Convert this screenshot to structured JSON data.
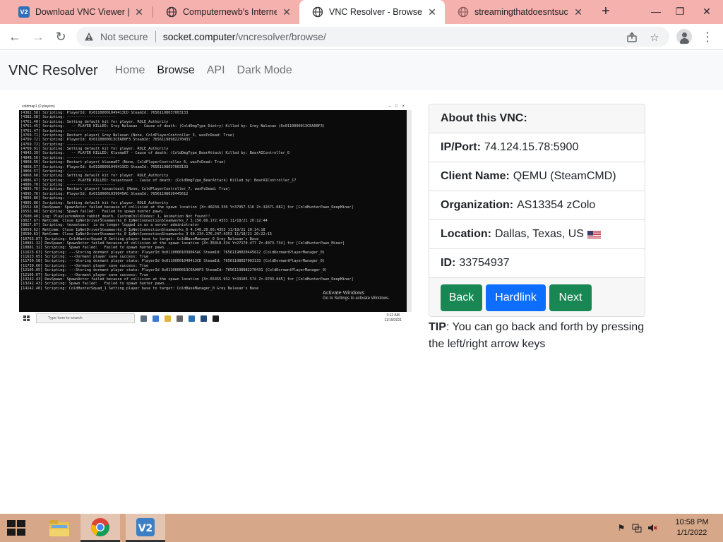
{
  "browser": {
    "tabs": [
      {
        "title": "Download VNC Viewer | VNC",
        "favicon": "vnc-icon",
        "active": false
      },
      {
        "title": "Computernewb's Internet M",
        "favicon": "globe-icon",
        "active": false
      },
      {
        "title": "VNC Resolver - Browse",
        "favicon": "globe-icon",
        "active": true
      },
      {
        "title": "streamingthatdoesntsuck.c",
        "favicon": "globe-icon",
        "active": false
      }
    ],
    "new_tab_label": "+",
    "window_controls": {
      "minimize": "—",
      "restore": "❐",
      "close": "✕"
    },
    "toolbar": {
      "back": "←",
      "forward": "→",
      "reload": "↻",
      "security_text": "Not secure",
      "url_host": "socket.computer",
      "url_path": "/vncresolver/browse/"
    }
  },
  "site": {
    "brand": "VNC Resolver",
    "nav": [
      {
        "label": "Home",
        "active": false
      },
      {
        "label": "Browse",
        "active": true
      },
      {
        "label": "API",
        "active": false
      },
      {
        "label": "Dark Mode",
        "active": false
      }
    ]
  },
  "vnc_screenshot": {
    "window_title": "coldmap1 (0 players)",
    "console_lines": [
      "[4382.58] Scripting: PlayerId: 0x01100001049413CD SteamId: 76561198037003133",
      "[4382.58] Scripting: ----------------------",
      "[4761.40] Scripting: Setting default kit for player. ROLE_Authority",
      "[4761.45] Scripting:   -- PLAYER KILLED: Grey Nalasan - Cause of death: (ColdDmgType_Dietry) Killed by: Grey Nalasan (0x0110000013CEA00F3)",
      "[4761.47] Scripting: ----------------------",
      "[4769.71] Scripting: Restart player( Grey Nalasan (None, ColdPlayerController_3, wasPcDead: True)",
      "[4769.72] Scripting: PlayerId: 0x0110000013CEA00F3 SteamId: 76561198982270431",
      "[4769.72] Scripting: ----------------------",
      "[4769.91] Scripting: Setting default kit for player. ROLE_Authority",
      "[4843.39] Scripting:   -- PLAYER KILLED: Klasma07 - Cause of death: (ColdDmgType_BearAttack) Killed by: BearAIController_0",
      "[4848.56] Scripting: ----------------------",
      "[4868.56] Scripting: Restart player( klasma07 (None, ColdPlayerController_6, wasPcDead: True)",
      "[4868.57] Scripting: PlayerId: 0x01100001049413CD SteamId: 76561198037003133",
      "[4868.57] Scripting: ----------------------",
      "[4868.60] Scripting: Setting default kit for player. ROLE_Authority",
      "[4886.47] Scripting:   -- PLAYER KILLED: texastoast - Cause of death: (ColdDmgType_BearAttack) Killed by: BearAIController_17",
      "[4886.70] Scripting: ----------------------",
      "[4895.76] Scripting: Restart player( texastoast (None, ColdPlayerController_7, wasPcDead: True)",
      "[4895.76] Scripting: PlayerId: 0x01100001039045AC SteamId: 76561198020445612",
      "[4895.86] Scripting: ----------------------",
      "[4895.86] Scripting: Setting default kit for player. ROLE_Authority",
      "[6552.68] DevSpawn: SpawnActor failed because of collision at the spawn location [X=-40234.336 Y=37957.516 Z=-32671.082] for [ColdHunterPawn_DeepMiner]",
      "[6552.68] Scripting: Spawn failed:   Failed to spawn hunter pawn...",
      "[7600.40] Log: PlayCustomAnim rabbit_death, CustomChildIndex: 1, Animation Not Found!!",
      "[8027.67] NetComm: Close IpNetDriverSteamworks_0 IpNetConnectionSteamworks_7 3.150.60.172:4353 11/18/21 20:12:44",
      "[8027.67] Scripting: texastoast  is no longer logged in as a server administrator",
      "[8059.62] NetComm: Close IpNetDriverSteamworks_0 IpNetConnectionSteamworks_6 4.148.28.65:4353 11/18/21 20:14:18",
      "[8590.63] NetComm: Close IpNetDriverSteamworks_0 IpNetConnectionSteamworks_3 60.234.176.247:4353 11/18/21 20:22:15",
      "[10763.87] Scripting: ColdHunterSquad_0 Setting player base to target: ColdBaseManager_0 Grey Nalasan's Base",
      "[10881.32] DevSpawn: SpawnActor failed because of collision at the spawn location [X=-35018.334 Y=27170.477 Z=-4073.734] for [ColdHunterPawn_Miner]",
      "[10881.32] Scripting: Spawn failed:   Failed to spawn hunter pawn...",
      "[11623.63] Scripting: ---Storing dormant player state: PlayerId 0x01100001039045AC SteamId: 76561198020445612 (ColdDormantPlayerManager_0)",
      "[11623.65] Scripting: ---Dormant player save success: True",
      "[11730.58] Scripting: ---Storing dormant player state: PlayerId 0x01100001049413CD SteamId: 76561198037003133 (ColdDormantPlayerManager_0)",
      "[11730.60] Scripting: ---Dormant player save success: True",
      "[12105.05] Scripting: ---Storing dormant player state: PlayerId 0x0110000013CEA00F3 SteamId: 76561198982270431 (ColdDormantPlayerManager_0)",
      "[12105.07] Scripting: ---Dormant player save success: True",
      "[13242.43] DevSpawn: SpawnActor failed because of collision at the spawn location [X=-65455.932 Y=33105.574 Z=-9703.045] for [ColdHunterPawn_DeepMiner]",
      "[13242.43] Scripting: Spawn failed:   Failed to spawn hunter pawn...",
      "[14142.40] Scripting: ColdHunterSquad_1 Setting player base to target: ColdBaseManager_0 Grey Nalasan's Base"
    ],
    "watermark_line1": "Activate Windows",
    "watermark_line2": "Go to Settings to activate Windows.",
    "taskbar_search": "Type here to search",
    "clock_time": "3:12 AM",
    "clock_date": "11/19/2021"
  },
  "about": {
    "header": "About this VNC:",
    "ip_label": "IP/Port:",
    "ip_value": "74.124.15.78:5900",
    "client_label": "Client Name:",
    "client_value": "QEMU (SteamCMD)",
    "org_label": "Organization:",
    "org_value": "AS13354 zColo",
    "location_label": "Location:",
    "location_value": "Dallas, Texas, US",
    "location_flag": "us-flag-icon",
    "id_label": "ID:",
    "id_value": "33754937",
    "buttons": {
      "back": "Back",
      "hardlink": "Hardlink",
      "next": "Next"
    },
    "colors": {
      "success": "#198754",
      "primary": "#0d6efd"
    }
  },
  "tip": {
    "label": "TIP",
    "text": ": You can go back and forth by pressing the left/right arrow keys"
  },
  "os_taskbar": {
    "time": "10:58 PM",
    "date": "1/1/2022",
    "apps": [
      "file-explorer-icon",
      "chrome-icon",
      "vnc-viewer-icon"
    ]
  }
}
